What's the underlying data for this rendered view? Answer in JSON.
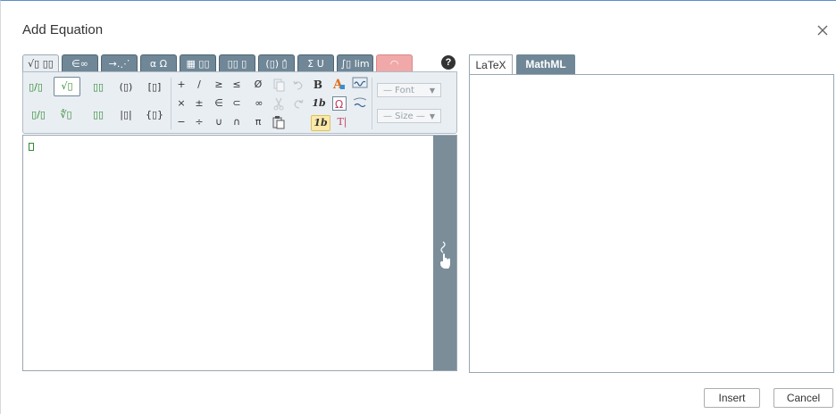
{
  "dialog": {
    "title": "Add Equation",
    "close_icon": "close-icon"
  },
  "toolbar": {
    "tabs": [
      {
        "label": "√▯ ▯▯",
        "name": "tab-fractions-roots"
      },
      {
        "label": "∈∞",
        "name": "tab-symbols"
      },
      {
        "label": "→.⋰",
        "name": "tab-arrows"
      },
      {
        "label": "α Ω",
        "name": "tab-greek"
      },
      {
        "label": "▦ ▯▯",
        "name": "tab-matrices"
      },
      {
        "label": "▯▯ ▯",
        "name": "tab-scripts"
      },
      {
        "label": "(▯) ▯̂",
        "name": "tab-decorations"
      },
      {
        "label": "Σ U",
        "name": "tab-big-operators"
      },
      {
        "label": "∫▯ lim",
        "name": "tab-calculus"
      },
      {
        "label": "◠",
        "name": "tab-handwriting"
      }
    ],
    "help_label": "?",
    "font_dropdown": "— Font",
    "size_dropdown": "— Size —",
    "symbols": {
      "fraction": "▯/▯",
      "sqrt": "√▯",
      "superscript": "▯▯",
      "parens": "(▯)",
      "brackets": "[▯]",
      "bevel_fraction": "▯/▯",
      "nth_root": "∜▯",
      "subscript": "▯▯",
      "abs": "|▯|",
      "braces": "{▯}",
      "plus": "+",
      "slash": "/",
      "times": "×",
      "plusminus": "±",
      "minus": "−",
      "divide": "÷",
      "geq": "≥",
      "leq": "≤",
      "in": "∈",
      "subset": "⊂",
      "union": "∪",
      "intersect": "∩",
      "emptyset": "Ø",
      "infinity": "∞",
      "pi": "π",
      "bold": "B",
      "italic_1b": "1b",
      "italic_1b_hl": "1b",
      "text_icon": "T|"
    }
  },
  "right_pane": {
    "tabs": [
      "LaTeX",
      "MathML"
    ]
  },
  "buttons": {
    "insert": "Insert",
    "cancel": "Cancel"
  }
}
